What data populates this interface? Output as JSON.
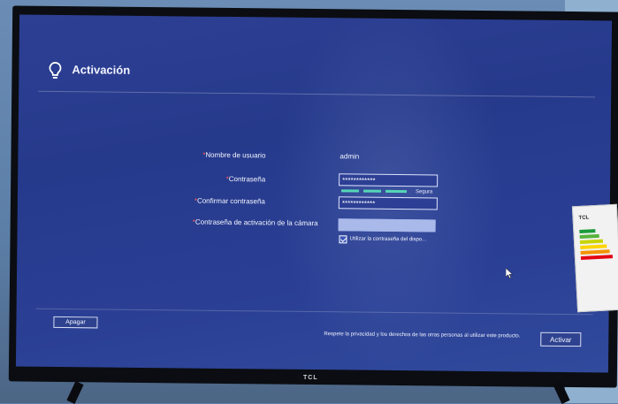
{
  "screen": {
    "title": "Activación",
    "form": {
      "username_label": "Nombre de usuario",
      "username_value": "admin",
      "password_label": "Contraseña",
      "password_value": "************",
      "strength_label": "Segura",
      "confirm_label": "Confirmar contraseña",
      "confirm_value": "************",
      "camera_password_label": "Contraseña de activación de la cámara",
      "camera_password_value": "",
      "use_device_password_label": "Utilizar la contraseña del dispo...",
      "use_device_password_checked": true,
      "required_mark": "*"
    },
    "footer": {
      "shutdown_button": "Apagar",
      "privacy_notice": "Respete la privacidad y los derechos de las otras personas al utilizar este producto.",
      "activate_button": "Activar"
    }
  },
  "tv": {
    "brand": "TCL"
  },
  "energy_label": {
    "brand": "TCL"
  },
  "colors": {
    "screen_bg": "#2a3d90",
    "strength_bar": "#55d6b6",
    "required": "#ff5a5a"
  }
}
